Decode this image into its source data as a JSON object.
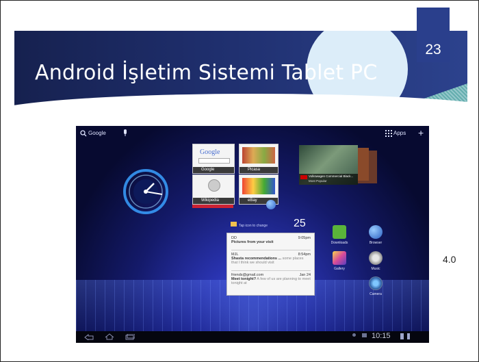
{
  "slide": {
    "title": "Android İşletim Sistemi Tablet PC",
    "number": "23",
    "side_label": "4.0"
  },
  "tablet": {
    "search_label": "Google",
    "apps_label": "Apps",
    "widgets": [
      {
        "caption": "Google",
        "logo": "Google"
      },
      {
        "caption": "Picasa"
      },
      {
        "caption": "Wikipedia"
      },
      {
        "caption": "eBay"
      }
    ],
    "video": {
      "line1": "Volkswagen Commercial Black...",
      "line2": "Most Popular"
    },
    "notification": {
      "count": "25",
      "hint": "Tap icon to change",
      "items": [
        {
          "from": "DD",
          "time": "9:05pm",
          "subject": "Pictures from your visit",
          "body": ""
        },
        {
          "from": "MJL",
          "time": "8:54pm",
          "subject": "Shasta recommendations ...",
          "body": "some places that I think we should visit"
        },
        {
          "from": "friends@gmail.com",
          "time": "Jan 24",
          "subject": "Meet tonight?",
          "body": "A few of us are planning to meet tonight at"
        }
      ]
    },
    "apps": [
      {
        "label": "Downloads"
      },
      {
        "label": "Browser"
      },
      {
        "label": "Gallery"
      },
      {
        "label": "Music"
      },
      {
        "label": "Camera"
      }
    ],
    "clock_text": "10:15"
  }
}
